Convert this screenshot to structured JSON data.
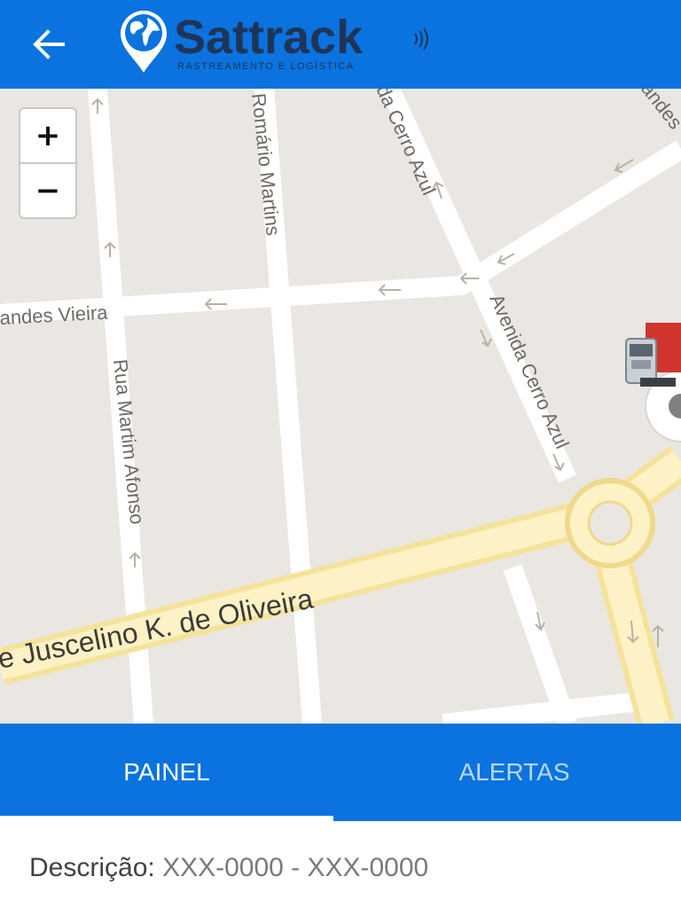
{
  "header": {
    "back_icon": "arrow-left-icon",
    "logo": {
      "brand": "Sattrack",
      "tagline": "RASTREAMENTO E LOGÍSTICA",
      "icon": "globe-pin-icon",
      "colors": {
        "text": "#1f3558",
        "globe": "#0a73df"
      }
    },
    "color": "#0a73df"
  },
  "map": {
    "zoom_in_label": "+",
    "zoom_out_label": "−",
    "streets": [
      "andes Vieira",
      "Romário Martins",
      "da Cerro Azul",
      "Avenida Cerro Azul",
      "Rua Martim Afonso",
      "e Juscelino K. de Oliveira",
      "andes"
    ],
    "marker_icon": "truck-icon"
  },
  "tabs": [
    {
      "label": "PAINEL",
      "active": true
    },
    {
      "label": "ALERTAS",
      "active": false
    }
  ],
  "detail": {
    "label": "Descrição:",
    "value": "XXX-0000 - XXX-0000"
  }
}
